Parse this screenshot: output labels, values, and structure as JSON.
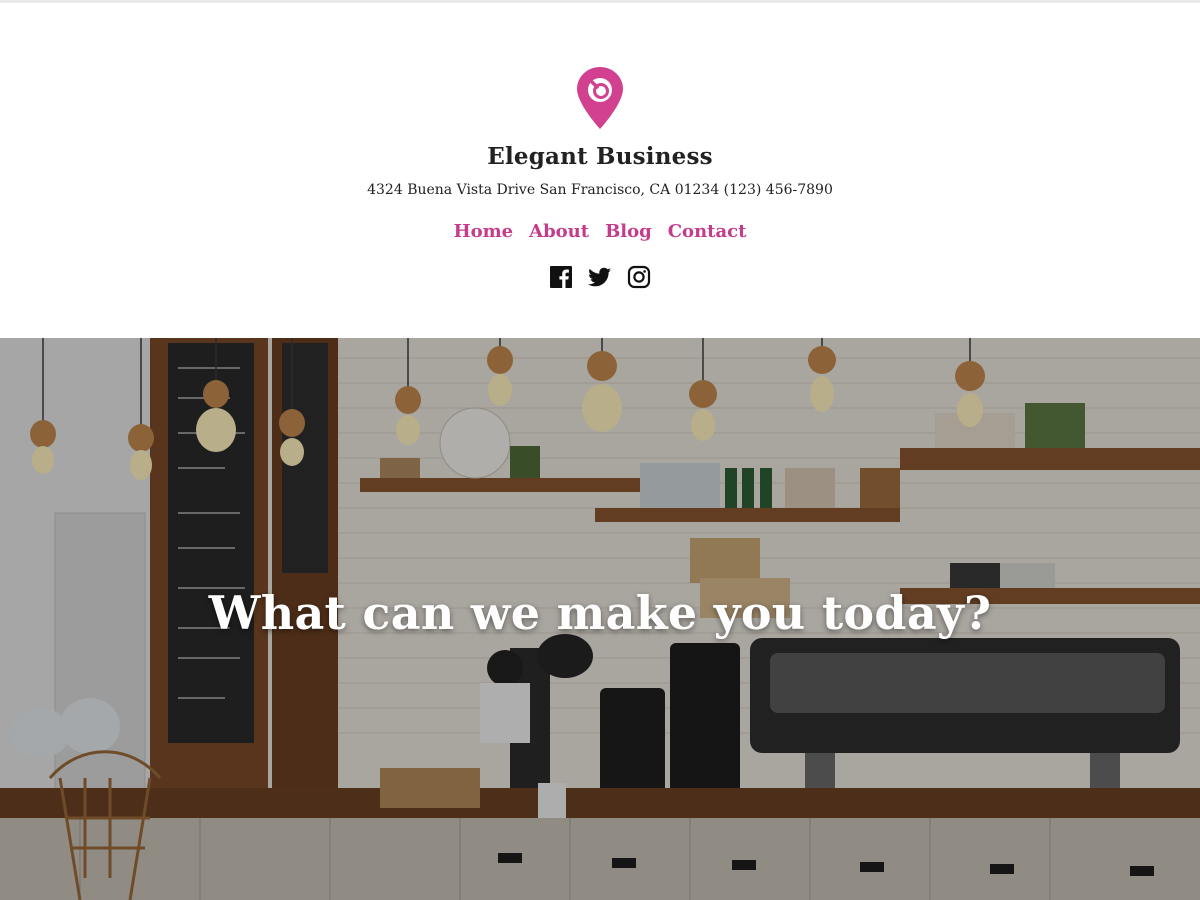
{
  "brand": {
    "name": "Elegant Business",
    "address": "4324 Buena Vista Drive San Francisco, CA 01234 (123) 456-7890",
    "logo_icon": "location-pin-search-icon",
    "accent_color": "#c53c8d"
  },
  "nav": {
    "items": [
      {
        "label": "Home"
      },
      {
        "label": "About"
      },
      {
        "label": "Blog"
      },
      {
        "label": "Contact"
      }
    ]
  },
  "social": [
    {
      "icon": "facebook-icon"
    },
    {
      "icon": "twitter-icon"
    },
    {
      "icon": "instagram-icon"
    }
  ],
  "hero": {
    "heading": "What can we make you today?",
    "background_image": "coffee-shop-counter-photo"
  }
}
